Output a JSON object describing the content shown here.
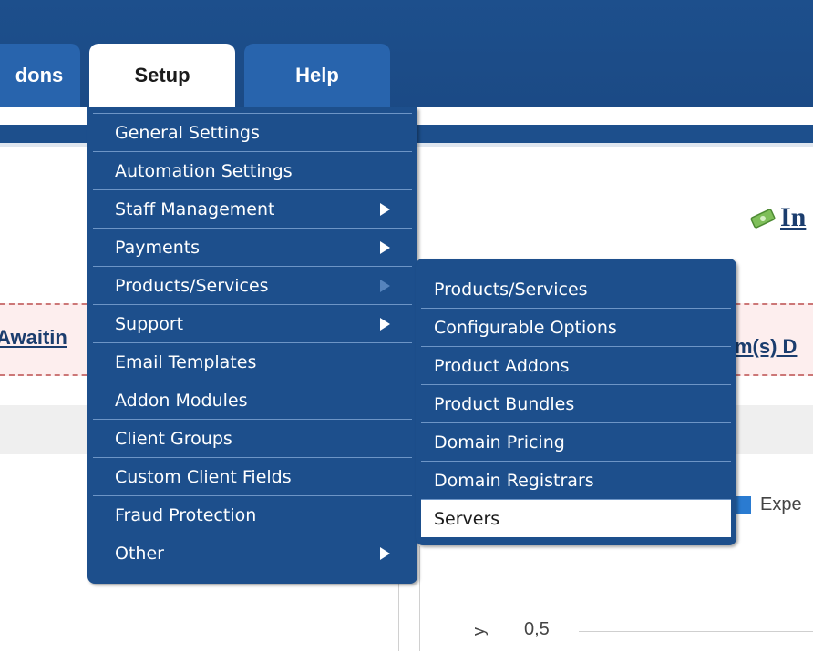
{
  "nav": {
    "tabs": [
      {
        "label": "dons"
      },
      {
        "label": "Setup"
      },
      {
        "label": "Help"
      }
    ]
  },
  "setup_menu": {
    "items": [
      {
        "label": "General Settings"
      },
      {
        "label": "Automation Settings"
      },
      {
        "label": "Staff Management"
      },
      {
        "label": "Payments"
      },
      {
        "label": "Products/Services"
      },
      {
        "label": "Support"
      },
      {
        "label": "Email Templates"
      },
      {
        "label": "Addon Modules"
      },
      {
        "label": "Client Groups"
      },
      {
        "label": "Custom Client Fields"
      },
      {
        "label": "Fraud Protection"
      },
      {
        "label": "Other"
      }
    ]
  },
  "products_submenu": {
    "items": [
      {
        "label": "Products/Services"
      },
      {
        "label": "Configurable Options"
      },
      {
        "label": "Product Addons"
      },
      {
        "label": "Product Bundles"
      },
      {
        "label": "Domain Pricing"
      },
      {
        "label": "Domain Registrars"
      },
      {
        "label": "Servers"
      }
    ]
  },
  "alerts": {
    "left": "Awaitin",
    "right": "m(s) D"
  },
  "widget": {
    "title": "In",
    "icon": "money-icon"
  },
  "chart": {
    "legend_label": "Expe",
    "tick_label": "0,5",
    "axis_label": "y"
  },
  "colors": {
    "nav_bg": "#1d4f8c",
    "tab_bg": "#2864ad",
    "legend_swatch": "#2a7bd1"
  }
}
